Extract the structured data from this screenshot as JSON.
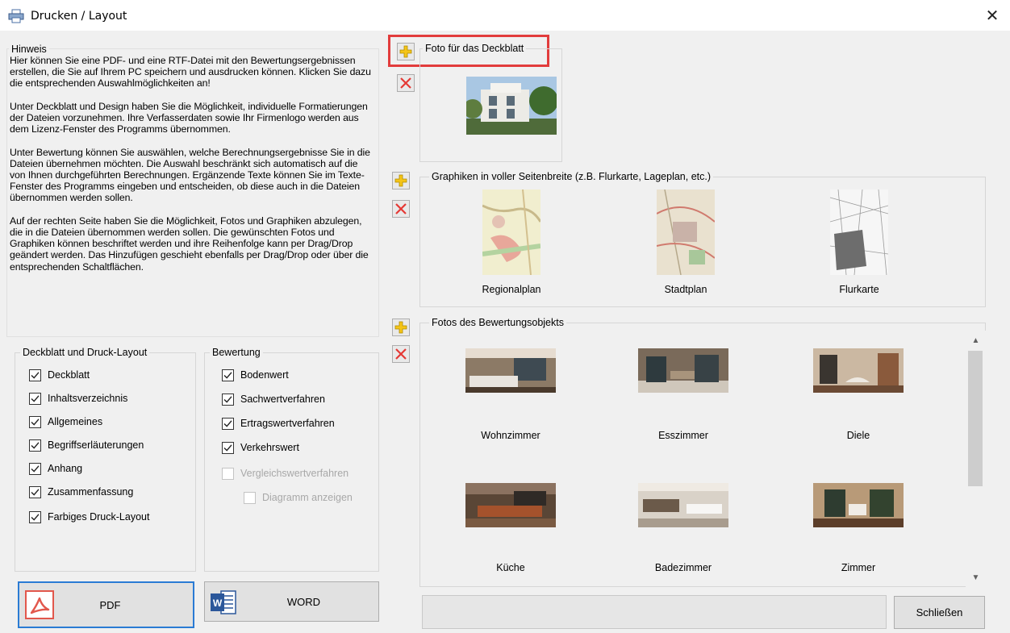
{
  "window": {
    "title": "Drucken / Layout",
    "close_symbol": "✕",
    "icon": "printer-icon"
  },
  "hint": {
    "label": "Hinweis",
    "paragraphs": [
      "Hier können Sie eine PDF- und eine RTF-Datei mit den Bewertungsergebnissen erstellen, die Sie auf Ihrem PC speichern und ausdrucken können. Klicken Sie dazu die entsprechenden Auswahlmöglichkeiten an!",
      "Unter Deckblatt und Design haben Sie die Möglichkeit, individuelle Formatierungen der Dateien vorzunehmen. Ihre Verfasserdaten sowie Ihr Firmenlogo werden aus dem Lizenz-Fenster des Programms übernommen.",
      "Unter Bewertung können Sie auswählen, welche Berechnungsergebnisse Sie in die Dateien übernehmen möchten. Die Auswahl beschränkt sich automatisch auf die von Ihnen durchgeführten Berechnungen. Ergänzende Texte können Sie im Texte-Fenster des Programms eingeben und entscheiden, ob diese auch in die Dateien übernommen werden sollen.",
      "Auf der rechten Seite haben Sie die Möglichkeit, Fotos und Graphiken abzulegen, die in die Dateien übernommen werden sollen. Die gewünschten Fotos und Graphiken können beschriftet werden und ihre Reihenfolge kann per Drag/Drop geändert werden. Das Hinzufügen geschieht ebenfalls per Drag/Drop oder über die entsprechenden Schaltflächen."
    ]
  },
  "layout_group": {
    "label": "Deckblatt und Druck-Layout",
    "items": [
      {
        "label": "Deckblatt",
        "checked": true
      },
      {
        "label": "Inhaltsverzeichnis",
        "checked": true
      },
      {
        "label": "Allgemeines",
        "checked": true
      },
      {
        "label": "Begriffserläuterungen",
        "checked": true
      },
      {
        "label": "Anhang",
        "checked": true
      },
      {
        "label": "Zusammenfassung",
        "checked": true
      },
      {
        "label": "Farbiges Druck-Layout",
        "checked": true
      }
    ]
  },
  "valuation_group": {
    "label": "Bewertung",
    "items": [
      {
        "label": "Bodenwert",
        "checked": true,
        "enabled": true
      },
      {
        "label": "Sachwertverfahren",
        "checked": true,
        "enabled": true
      },
      {
        "label": "Ertragswertverfahren",
        "checked": true,
        "enabled": true
      },
      {
        "label": "Verkehrswert",
        "checked": true,
        "enabled": true
      },
      {
        "label": "Vergleichswertverfahren",
        "checked": false,
        "enabled": false
      },
      {
        "label": "Diagramm anzeigen",
        "checked": false,
        "enabled": false
      }
    ]
  },
  "buttons": {
    "pdf": "PDF",
    "word": "WORD",
    "close": "Schließen"
  },
  "cover_photo": {
    "label": "Foto für das Deckblatt"
  },
  "graphics": {
    "label": "Graphiken in voller Seitenbreite (z.B. Flurkarte, Lageplan, etc.)",
    "items": [
      "Regionalplan",
      "Stadtplan",
      "Flurkarte"
    ]
  },
  "photos": {
    "label": "Fotos des Bewertungsobjekts",
    "items": [
      "Wohnzimmer",
      "Esszimmer",
      "Diele",
      "Küche",
      "Badezimmer",
      "Zimmer"
    ]
  },
  "colors": {
    "highlight": "#e23c3c",
    "focus": "#2a7bd4",
    "add_icon": "#f5c518",
    "remove_icon": "#e53935",
    "pdf_icon": "#e2574c",
    "word_icon": "#2b579a"
  }
}
